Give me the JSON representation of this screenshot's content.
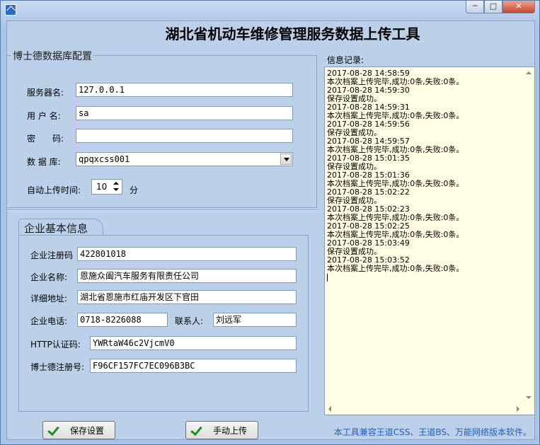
{
  "window": {
    "minimize_glyph": "─",
    "maximize_glyph": "□",
    "close_glyph": "✕"
  },
  "app_title": "湖北省机动车维修管理服务数据上传工具",
  "db_config": {
    "title": "博士德数据库配置",
    "server_label": "服务器名:",
    "server_value": "127.0.0.1",
    "user_label": "用 户 名:",
    "user_value": "sa",
    "password_label": "密　　码:",
    "password_value": "",
    "database_label": "数 据 库:",
    "database_value": "qpqxcss001",
    "interval_label": "自动上传时间:",
    "interval_value": "10",
    "interval_unit": "分"
  },
  "company": {
    "title": "企业基本信息",
    "reg_code_label": "企业注册码",
    "reg_code_value": "422801018",
    "name_label": "企业名称:",
    "name_value": "恩施众阖汽车服务有限责任公司",
    "address_label": "详细地址:",
    "address_value": "湖北省恩施市红庙开发区下官田",
    "phone_label": "企业电话:",
    "phone_value": "0718-8226088",
    "contact_label": "联系人:",
    "contact_value": "刘远军",
    "http_label": "HTTP认证码:",
    "http_value": "YWRtaW46c2VjcmV0",
    "bsd_label": "博士德注册号:",
    "bsd_value": "F96CF157FC7EC096B3BC"
  },
  "log": {
    "label": "信息记录:",
    "lines": [
      "2017-08-28 14:58:59",
      "本次档案上传完毕,成功:0条,失败:0条。",
      "2017-08-28 14:59:30",
      "保存设置成功。",
      "2017-08-28 14:59:31",
      "本次档案上传完毕,成功:0条,失败:0条。",
      "2017-08-28 14:59:56",
      "保存设置成功。",
      "2017-08-28 14:59:57",
      "本次档案上传完毕,成功:0条,失败:0条。",
      "2017-08-28 15:01:35",
      "保存设置成功。",
      "2017-08-28 15:01:36",
      "本次档案上传完毕,成功:0条,失败:0条。",
      "2017-08-28 15:02:22",
      "保存设置成功。",
      "2017-08-28 15:02:23",
      "本次档案上传完毕,成功:0条,失败:0条。",
      "2017-08-28 15:02:25",
      "本次档案上传完毕,成功:0条,失败:0条。",
      "2017-08-28 15:03:49",
      "保存设置成功。",
      "2017-08-28 15:03:52",
      "本次档案上传完毕,成功:0条,失败:0条。"
    ]
  },
  "buttons": {
    "save": "保存设置",
    "upload": "手动上传"
  },
  "footer_note": "本工具兼容王道CSS、王道BS、万能网络版本软件。"
}
